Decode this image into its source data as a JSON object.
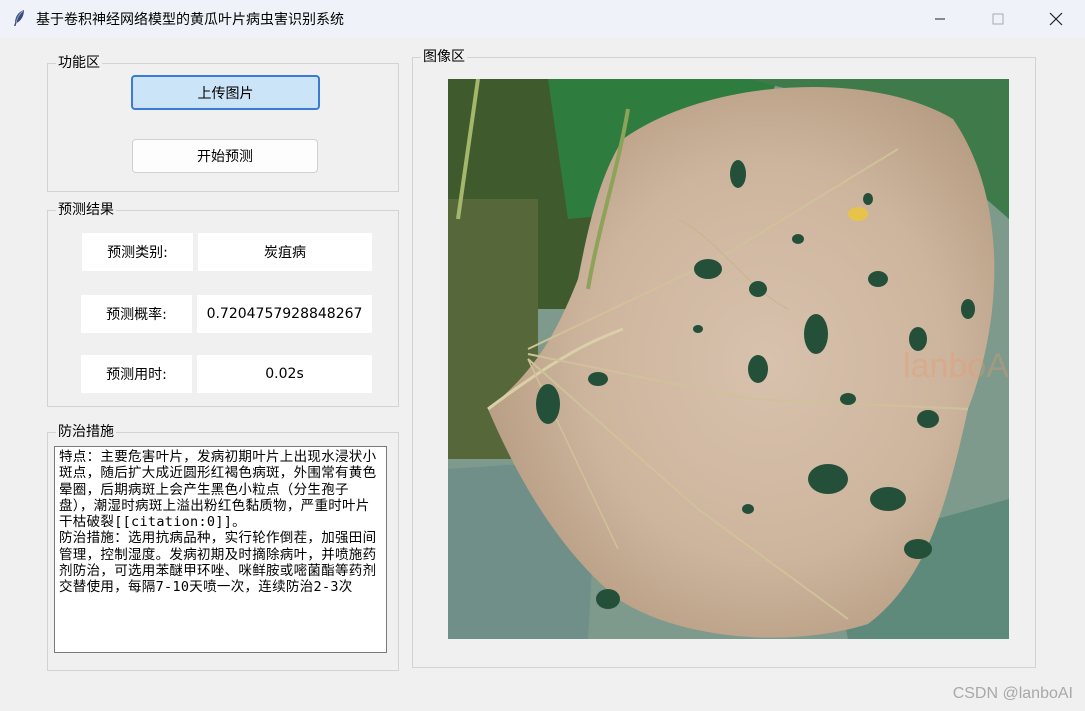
{
  "window": {
    "title": "基于卷积神经网络模型的黄瓜叶片病虫害识别系统",
    "icons": [
      "feather-icon",
      "minimize-icon",
      "maximize-icon",
      "close-icon"
    ]
  },
  "function_panel": {
    "title": "功能区",
    "upload_label": "上传图片",
    "predict_label": "开始预测"
  },
  "result_panel": {
    "title": "预测结果",
    "rows": [
      {
        "label": "预测类别:",
        "value": "炭疽病"
      },
      {
        "label": "预测概率:",
        "value": "0.7204757928848267"
      },
      {
        "label": "预测用时:",
        "value": "0.02s"
      }
    ]
  },
  "treatment_panel": {
    "title": "防治措施",
    "paragraphs": [
      "特点：主要危害叶片，发病初期叶片上出现水浸状小斑点，随后扩大成近圆形红褐色病斑，外围常有黄色晕圈，后期病斑上会产生黑色小粒点（分生孢子盘），潮湿时病斑上溢出粉红色黏质物，严重时叶片干枯破裂[[citation:0]]。",
      "防治措施：选用抗病品种，实行轮作倒茬，加强田间管理，控制湿度。发病初期及时摘除病叶，并喷施药剂防治，可选用苯醚甲环唑、咪鲜胺或嘧菌酯等药剂交替使用，每隔7-10天喷一次，连续防治2-3次"
    ]
  },
  "image_panel": {
    "title": "图像区",
    "overlay_text": "lanboAI"
  },
  "watermark": "CSDN @lanboAI",
  "colors": {
    "titlebar_bg": "#eff3f9",
    "window_bg": "#f0f0f0",
    "primary_button_bg": "#cce4f7",
    "primary_button_border": "#3a7bd5"
  }
}
